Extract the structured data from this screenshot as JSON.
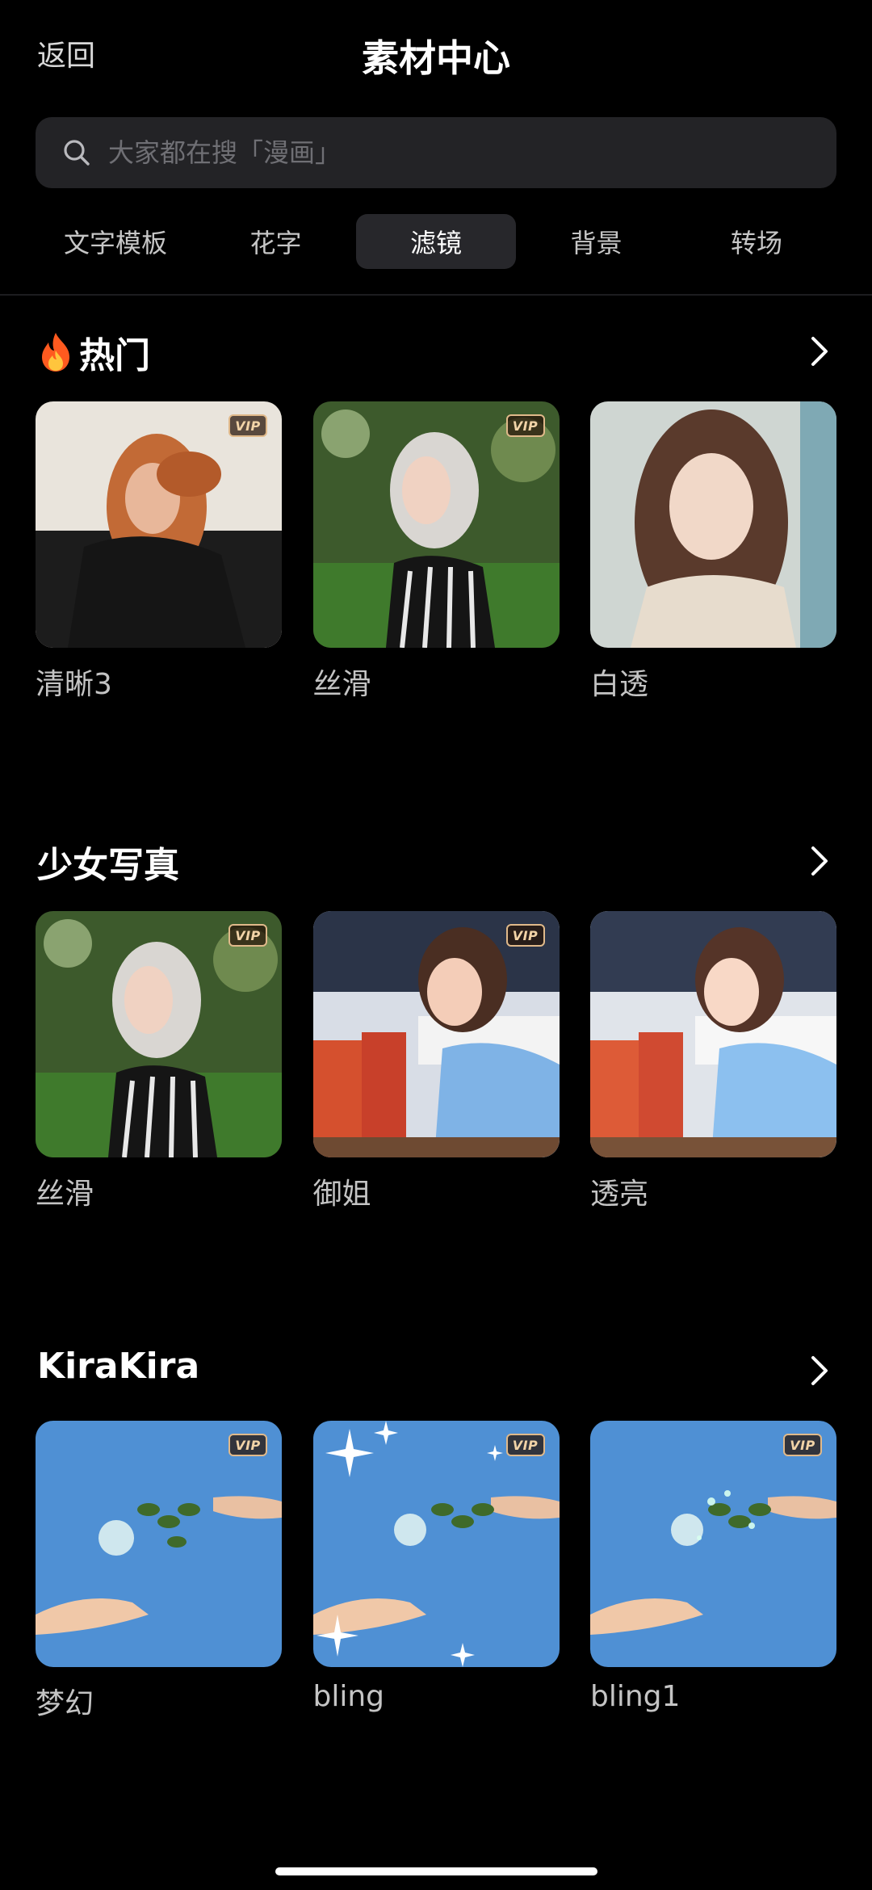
{
  "header": {
    "back_label": "返回",
    "title": "素材中心"
  },
  "search": {
    "placeholder": "大家都在搜「漫画」"
  },
  "tabs": [
    {
      "label": "文字模板",
      "active": false
    },
    {
      "label": "花字",
      "active": false
    },
    {
      "label": "滤镜",
      "active": true
    },
    {
      "label": "背景",
      "active": false
    },
    {
      "label": "转场",
      "active": false
    }
  ],
  "sections": [
    {
      "title": "热门",
      "icon": "fire-icon",
      "items": [
        {
          "label": "清晰3",
          "vip": "VIP"
        },
        {
          "label": "丝滑",
          "vip": "VIP"
        },
        {
          "label": "白透",
          "vip": ""
        }
      ]
    },
    {
      "title": "少女写真",
      "items": [
        {
          "label": "丝滑",
          "vip": "VIP"
        },
        {
          "label": "御姐",
          "vip": "VIP"
        },
        {
          "label": "透亮",
          "vip": ""
        }
      ]
    },
    {
      "title": "KiraKira",
      "items": [
        {
          "label": "梦幻",
          "vip": "VIP"
        },
        {
          "label": "bling",
          "vip": "VIP"
        },
        {
          "label": "bling1",
          "vip": "VIP"
        }
      ]
    }
  ],
  "colors": {
    "background": "#000000",
    "tab_active_bg": "#27272b",
    "search_bg": "#232326",
    "vip_gold": "#e0b98a"
  }
}
